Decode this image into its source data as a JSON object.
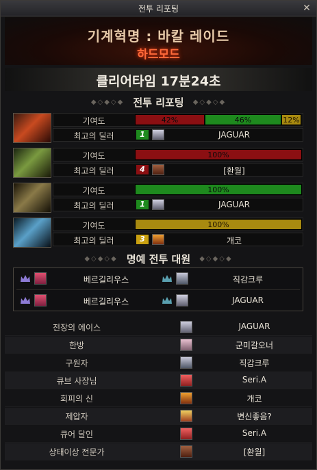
{
  "window": {
    "title": "전투 리포팅",
    "close_icon": "close-icon"
  },
  "header": {
    "raid_title": "기계혁명 : 바칼 레이드",
    "difficulty": "하드모드"
  },
  "clear_time": "클리어타임  17분24초",
  "report_section": {
    "title": "전투 리포팅"
  },
  "contribution_label": "기여도",
  "top_dealer_label": "최고의 딜러",
  "bosses": [
    {
      "segments": [
        {
          "label": "42%",
          "value": 42,
          "color": "#8b0f12"
        },
        {
          "label": "46%",
          "value": 46,
          "color": "#1e8a1e"
        },
        {
          "label": "12%",
          "value": 12,
          "color": "#a88a10"
        }
      ],
      "dealer_rank": "1",
      "dealer_rank_color": "#1e8a1e",
      "dealer": "JAGUAR"
    },
    {
      "segments": [
        {
          "label": "100%",
          "value": 100,
          "color": "#8b0f12"
        }
      ],
      "dealer_rank": "4",
      "dealer_rank_color": "#8b0f12",
      "dealer": "[환월]"
    },
    {
      "segments": [
        {
          "label": "100%",
          "value": 100,
          "color": "#1e8a1e"
        }
      ],
      "dealer_rank": "1",
      "dealer_rank_color": "#1e8a1e",
      "dealer": "JAGUAR"
    },
    {
      "segments": [
        {
          "label": "100%",
          "value": 100,
          "color": "#a88a10"
        }
      ],
      "dealer_rank": "3",
      "dealer_rank_color": "#c9a010",
      "dealer": "개코"
    }
  ],
  "honor_section": {
    "title": "명예 전투 대원",
    "rows": [
      {
        "left": "베르길리우스",
        "right": "직감크루"
      },
      {
        "left": "베르길리우스",
        "right": "JAGUAR"
      }
    ]
  },
  "awards": [
    {
      "title": "전장의 에이스",
      "player": "JAGUAR"
    },
    {
      "title": "한방",
      "player": "군미갈오너"
    },
    {
      "title": "구원자",
      "player": "직감크루"
    },
    {
      "title": "큐브 사장님",
      "player": "Seri.A"
    },
    {
      "title": "회피의 신",
      "player": "개코"
    },
    {
      "title": "제압자",
      "player": "변신좋음?"
    },
    {
      "title": "큐어 달인",
      "player": "Seri.A"
    },
    {
      "title": "상태이상 전문가",
      "player": "[환월]"
    }
  ]
}
